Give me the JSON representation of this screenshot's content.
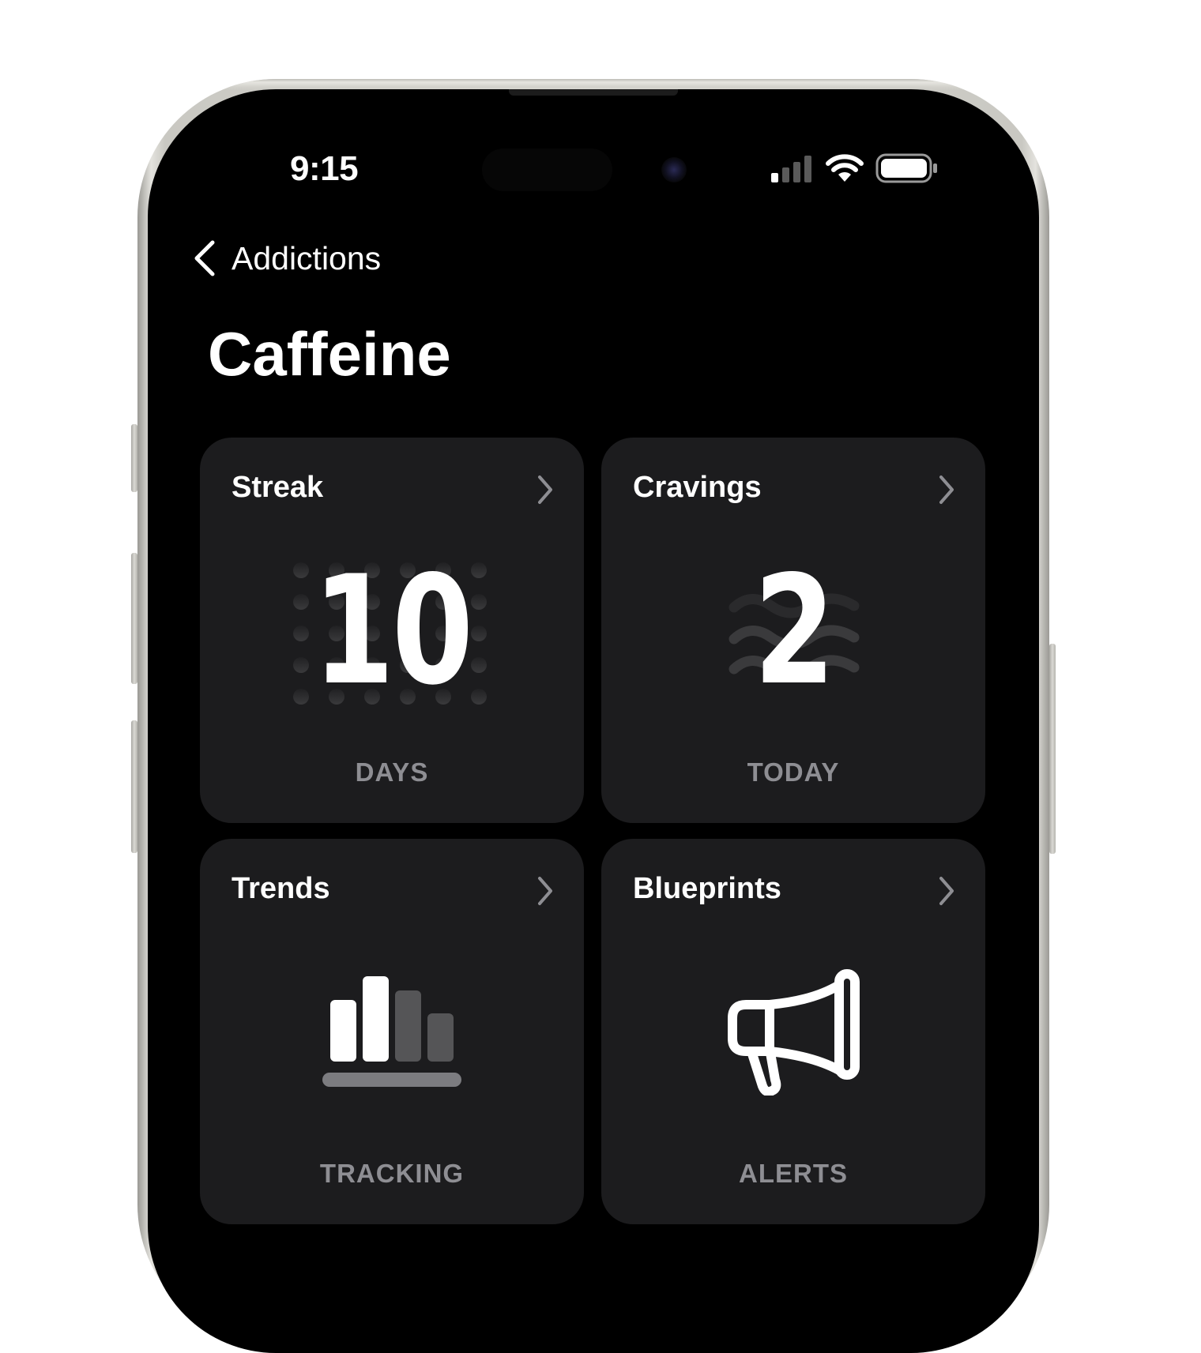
{
  "status_bar": {
    "time": "9:15",
    "icons": [
      "cellular-signal-icon",
      "wifi-icon",
      "battery-icon"
    ]
  },
  "nav": {
    "back_icon": "chevron-left-icon",
    "back_label": "Addictions"
  },
  "page": {
    "title": "Caffeine"
  },
  "cards": [
    {
      "title": "Streak",
      "value": "10",
      "caption": "DAYS",
      "icon": "dot-grid-icon"
    },
    {
      "title": "Cravings",
      "value": "2",
      "caption": "TODAY",
      "icon": "waves-icon"
    },
    {
      "title": "Trends",
      "caption": "TRACKING",
      "icon": "bar-chart-icon"
    },
    {
      "title": "Blueprints",
      "caption": "ALERTS",
      "icon": "megaphone-icon"
    }
  ],
  "colors": {
    "background": "#000000",
    "card": "#1c1c1e",
    "caption": "#8e8e93",
    "text": "#ffffff"
  }
}
